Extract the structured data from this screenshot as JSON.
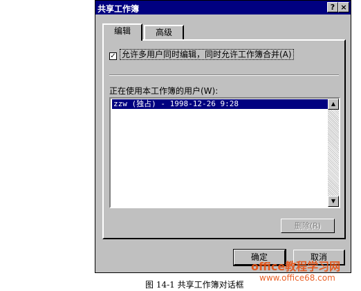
{
  "dialog": {
    "title": "共享工作簿",
    "help_glyph": "?",
    "close_glyph": "×"
  },
  "tabs": [
    {
      "label": "编辑",
      "active": true
    },
    {
      "label": "高级",
      "active": false
    }
  ],
  "options": {
    "allow_multiuser_checked": true,
    "check_glyph": "✓",
    "allow_multiuser_label": "允许多用户同时编辑，同时允许工作簿合并(A)"
  },
  "users": {
    "label": "正在使用本工作簿的用户(W):",
    "items": [
      "zzw (独占) - 1998-12-26 9:28"
    ]
  },
  "scrollbar": {
    "up_glyph": "▲",
    "down_glyph": "▼"
  },
  "buttons": {
    "remove_user": "删除(R)",
    "ok": "确定",
    "cancel": "取消"
  },
  "caption": "图 14-1 共享工作簿对话框",
  "watermark": {
    "text": "office教程学习网",
    "url": "www.office68.com"
  },
  "colors": {
    "titlebar": "#000080",
    "face": "#c0c0c0",
    "selection": "#000080",
    "watermark": "#e85010"
  }
}
